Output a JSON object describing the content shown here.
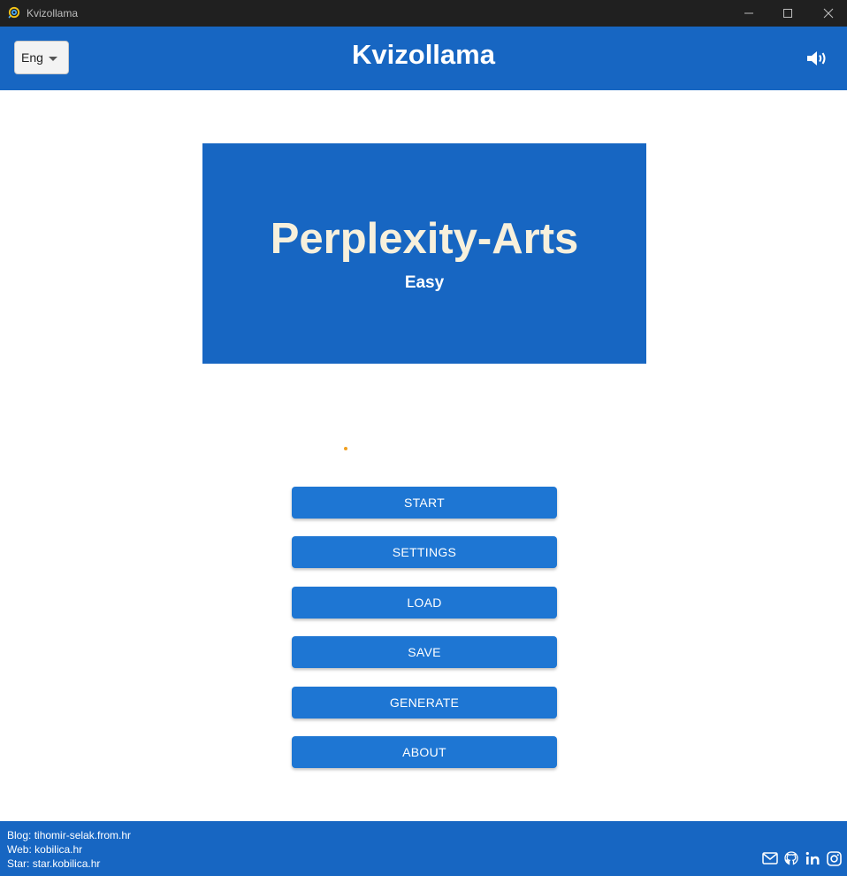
{
  "window": {
    "title": "Kvizollama"
  },
  "header": {
    "language": "Eng",
    "title": "Kvizollama",
    "volume_icon": "volume-icon"
  },
  "banner": {
    "quiz_title": "Perplexity-Arts",
    "difficulty": "Easy"
  },
  "menu": {
    "buttons": [
      {
        "label": "START"
      },
      {
        "label": "SETTINGS"
      },
      {
        "label": "LOAD"
      },
      {
        "label": "SAVE"
      },
      {
        "label": "GENERATE"
      },
      {
        "label": "ABOUT"
      }
    ]
  },
  "footer": {
    "blog_label": "Blog:",
    "blog_value": "tihomir-selak.from.hr",
    "web_label": "Web:",
    "web_value": "kobilica.hr",
    "star_label": "Star:",
    "star_value": "star.kobilica.hr",
    "social_icons": [
      "mail-icon",
      "github-icon",
      "linkedin-icon",
      "instagram-icon"
    ]
  },
  "colors": {
    "primary": "#1766c2",
    "button": "#1e76d3",
    "titlebar": "#202020",
    "banner_title": "#f7f0dc"
  }
}
